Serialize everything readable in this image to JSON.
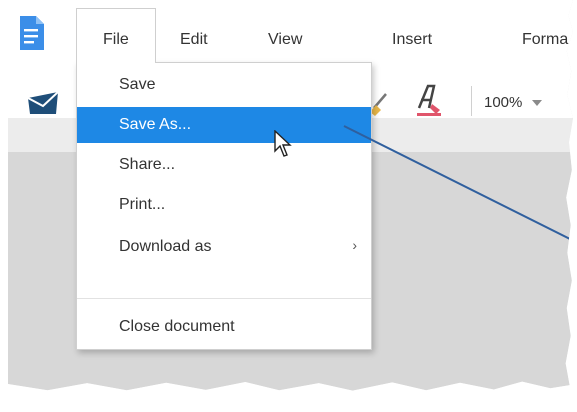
{
  "menubar": {
    "items": [
      {
        "id": "file",
        "label": "File"
      },
      {
        "id": "edit",
        "label": "Edit"
      },
      {
        "id": "view",
        "label": "View"
      },
      {
        "id": "insert",
        "label": "Insert"
      },
      {
        "id": "format",
        "label": "Forma"
      }
    ]
  },
  "toolbar": {
    "zoom": "100%",
    "icons": [
      "email-icon",
      "clear-format-icon",
      "text-color-icon"
    ]
  },
  "file_menu": {
    "items": [
      {
        "label": "Save"
      },
      {
        "label": "Save As..."
      },
      {
        "label": "Share..."
      },
      {
        "label": "Print..."
      },
      {
        "label": "Download as",
        "submenu_arrow": "›"
      },
      {
        "label": "Close document"
      }
    ],
    "highlighted_index": 1
  },
  "colors": {
    "accent": "#1e88e5",
    "logo": "#3b8ee8",
    "callout_line": "#2f5f9e",
    "canvas": "#d7d7d7"
  }
}
